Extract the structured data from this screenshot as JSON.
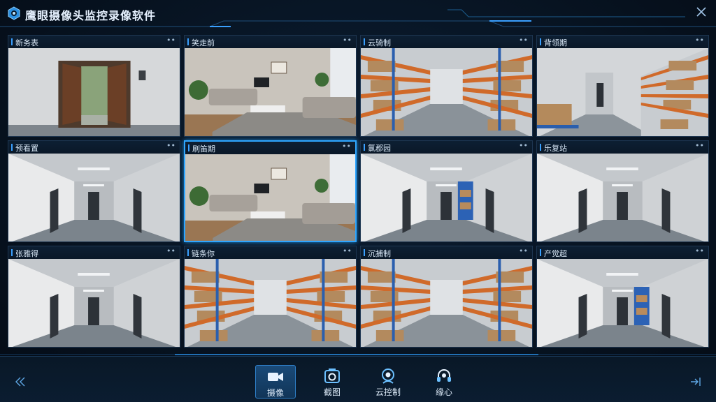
{
  "app": {
    "title": "鹰眼摄像头监控录像软件"
  },
  "grid": {
    "selected_index": 5,
    "cameras": [
      {
        "label": "新务表",
        "scene": "door"
      },
      {
        "label": "笑走前",
        "scene": "living"
      },
      {
        "label": "云骑制",
        "scene": "warehouse"
      },
      {
        "label": "背领期",
        "scene": "hall-warehouse"
      },
      {
        "label": "预看置",
        "scene": "hallway"
      },
      {
        "label": "刷笛期",
        "scene": "living"
      },
      {
        "label": "氯郡园",
        "scene": "hallway-shelf"
      },
      {
        "label": "乐复站",
        "scene": "hallway"
      },
      {
        "label": "张雅得",
        "scene": "hallway"
      },
      {
        "label": "链条你",
        "scene": "warehouse"
      },
      {
        "label": "沉捕制",
        "scene": "warehouse"
      },
      {
        "label": "产觉超",
        "scene": "hallway-shelf"
      }
    ],
    "more_glyph": "••"
  },
  "toolbar": {
    "items": [
      {
        "label": "摄像",
        "icon": "video-camera-icon",
        "active": true
      },
      {
        "label": "截图",
        "icon": "screenshot-icon",
        "active": false
      },
      {
        "label": "云控制",
        "icon": "ptz-control-icon",
        "active": false
      },
      {
        "label": "缘心",
        "icon": "headset-icon",
        "active": false
      }
    ]
  },
  "colors": {
    "accent": "#2fa6ff",
    "background": "#071321",
    "active_tool": "#1a4a78"
  }
}
